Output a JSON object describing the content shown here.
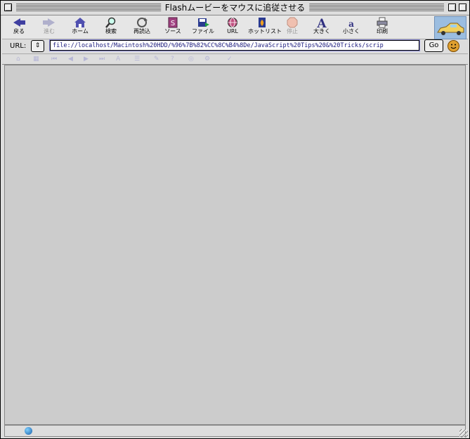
{
  "window": {
    "title": "Flashムービーをマウスに追従させる"
  },
  "toolbar": {
    "buttons": [
      {
        "label": "戻る",
        "icon": "back-arrow-icon"
      },
      {
        "label": "進む",
        "icon": "forward-arrow-icon"
      },
      {
        "label": "ホーム",
        "icon": "home-icon"
      },
      {
        "label": "検索",
        "icon": "magnifier-icon"
      },
      {
        "label": "再読込",
        "icon": "reload-icon"
      },
      {
        "label": "ソース",
        "icon": "source-icon"
      },
      {
        "label": "ファイル",
        "icon": "file-icon"
      },
      {
        "label": "URL",
        "icon": "globe-icon"
      },
      {
        "label": "ホットリスト",
        "icon": "hotlist-icon"
      },
      {
        "label": "停止",
        "icon": "stop-icon"
      },
      {
        "label": "大きく",
        "icon": "font-larger-icon"
      },
      {
        "label": "小さく",
        "icon": "font-smaller-icon"
      },
      {
        "label": "印刷",
        "icon": "printer-icon"
      }
    ]
  },
  "urlbar": {
    "label": "URL:",
    "value": "file://localhost/Macintosh%20HDD/%96%7B%82%CC%8C%B4%8De/JavaScript%20Tips%20&%20Tricks/scrip",
    "go_label": "Go"
  },
  "colors": {
    "content_bg": "#cccccc",
    "chrome_bg": "#dddddd",
    "url_text": "#202080"
  }
}
